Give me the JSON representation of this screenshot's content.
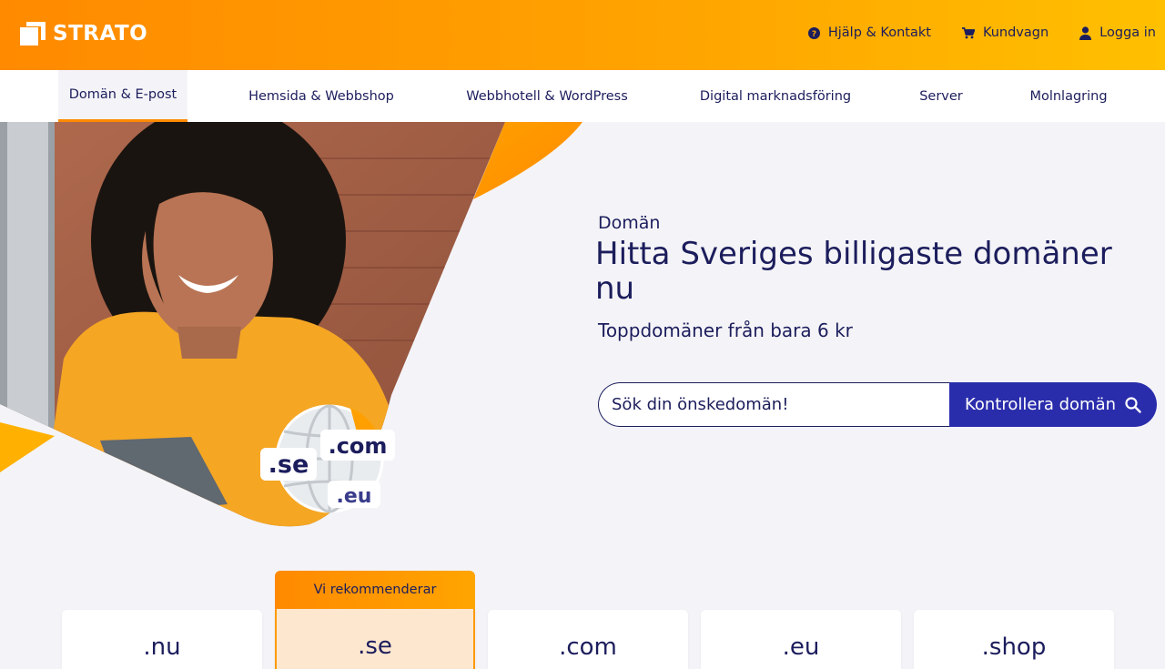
{
  "brand": {
    "name": "STRATO"
  },
  "header": {
    "links": [
      {
        "label": "Hjälp & Kontakt",
        "icon": "help-icon"
      },
      {
        "label": "Kundvagn",
        "icon": "cart-icon"
      },
      {
        "label": "Logga in",
        "icon": "user-icon"
      }
    ]
  },
  "nav": {
    "items": [
      {
        "label": "Domän & E-post",
        "active": true
      },
      {
        "label": "Hemsida & Webbshop"
      },
      {
        "label": "Webbhotell & WordPress"
      },
      {
        "label": "Digital marknadsföring"
      },
      {
        "label": "Server"
      },
      {
        "label": "Molnlagring"
      }
    ]
  },
  "hero": {
    "eyebrow": "Domän",
    "headline": "Hitta Sveriges billigaste domäner nu",
    "subline": "Toppdomäner från bara 6 kr",
    "search_placeholder": "Sök din önskedomän!",
    "search_button": "Kontrollera domän",
    "globe_tlds": [
      ".com",
      ".se",
      ".eu"
    ]
  },
  "recommend_badge": "Vi rekommenderar",
  "domains": [
    ".nu",
    ".se",
    ".com",
    ".eu",
    ".shop"
  ],
  "colors": {
    "accent": "#ff8a00",
    "navy": "#1c1d5c",
    "button": "#2a2dab",
    "recommended": "#fde7cf"
  }
}
